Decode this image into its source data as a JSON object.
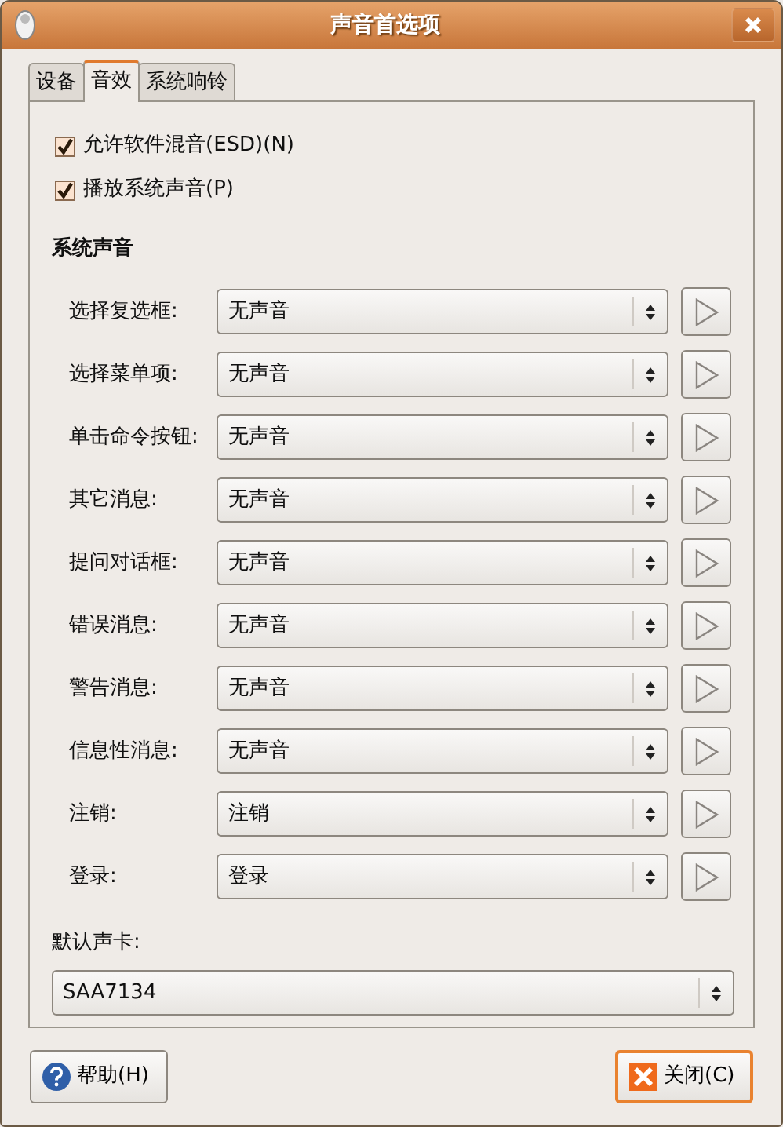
{
  "window": {
    "title": "声音首选项"
  },
  "tabs": [
    {
      "label": "设备",
      "selected": false
    },
    {
      "label": "音效",
      "selected": true
    },
    {
      "label": "系统响铃",
      "selected": false
    }
  ],
  "options": [
    {
      "label": "允许软件混音(ESD)(N)",
      "checked": true
    },
    {
      "label": "播放系统声音(P)",
      "checked": true
    }
  ],
  "section_title": "系统声音",
  "sounds": [
    {
      "label": "选择复选框:",
      "value": "无声音"
    },
    {
      "label": "选择菜单项:",
      "value": "无声音"
    },
    {
      "label": "单击命令按钮:",
      "value": "无声音"
    },
    {
      "label": "其它消息:",
      "value": "无声音"
    },
    {
      "label": "提问对话框:",
      "value": "无声音"
    },
    {
      "label": "错误消息:",
      "value": "无声音"
    },
    {
      "label": "警告消息:",
      "value": "无声音"
    },
    {
      "label": "信息性消息:",
      "value": "无声音"
    },
    {
      "label": "注销:",
      "value": "注销"
    },
    {
      "label": "登录:",
      "value": "登录"
    }
  ],
  "default_card": {
    "label": "默认声卡:",
    "value": "SAA7134"
  },
  "buttons": [
    {
      "kind": "help",
      "label": "帮助(H)",
      "focused": false
    },
    {
      "kind": "close",
      "label": "关闭(C)",
      "focused": true
    }
  ]
}
